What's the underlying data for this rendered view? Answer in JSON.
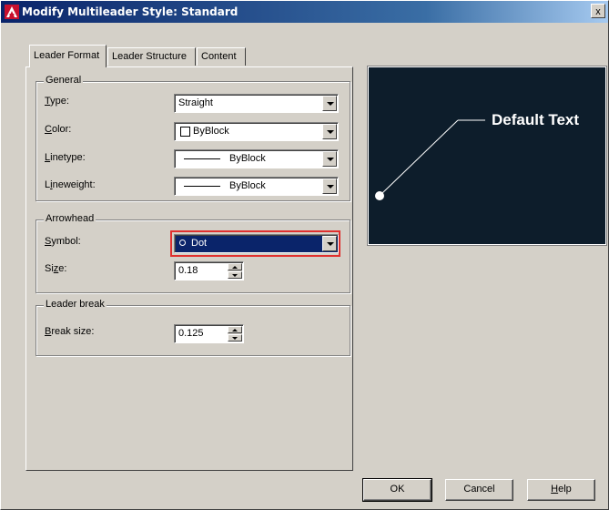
{
  "window": {
    "title": "Modify Multileader Style: Standard",
    "close_glyph": "x"
  },
  "tabs": [
    {
      "label": "Leader Format",
      "active": true
    },
    {
      "label": "Leader Structure",
      "active": false
    },
    {
      "label": "Content",
      "active": false
    }
  ],
  "general": {
    "title": "General",
    "type_label_mn": "T",
    "type_label_rest": "ype:",
    "type_value": "Straight",
    "color_label_mn": "C",
    "color_label_rest": "olor:",
    "color_value": "ByBlock",
    "linetype_label_mn": "L",
    "linetype_label_rest": "inetype:",
    "linetype_value": "ByBlock",
    "lineweight_label_pre": "L",
    "lineweight_label_mn": "i",
    "lineweight_label_rest": "neweight:",
    "lineweight_value": "ByBlock"
  },
  "arrowhead": {
    "title": "Arrowhead",
    "symbol_label_mn": "S",
    "symbol_label_rest": "ymbol:",
    "symbol_value": "Dot",
    "size_label_pre": "Si",
    "size_label_mn": "z",
    "size_label_rest": "e:",
    "size_value": "0.18"
  },
  "leader_break": {
    "title": "Leader break",
    "break_size_label_mn": "B",
    "break_size_label_rest": "reak size:",
    "break_size_value": "0.125"
  },
  "preview": {
    "text": "Default Text",
    "background": "#0d1d2b"
  },
  "buttons": {
    "ok": "OK",
    "cancel": "Cancel",
    "help_mn": "H",
    "help_rest": "elp"
  },
  "colors": {
    "title_bar": "#0a246a",
    "dialog_bg": "#d4d0c8",
    "highlight_border": "#e0302e",
    "selected_bg": "#0a246a"
  }
}
